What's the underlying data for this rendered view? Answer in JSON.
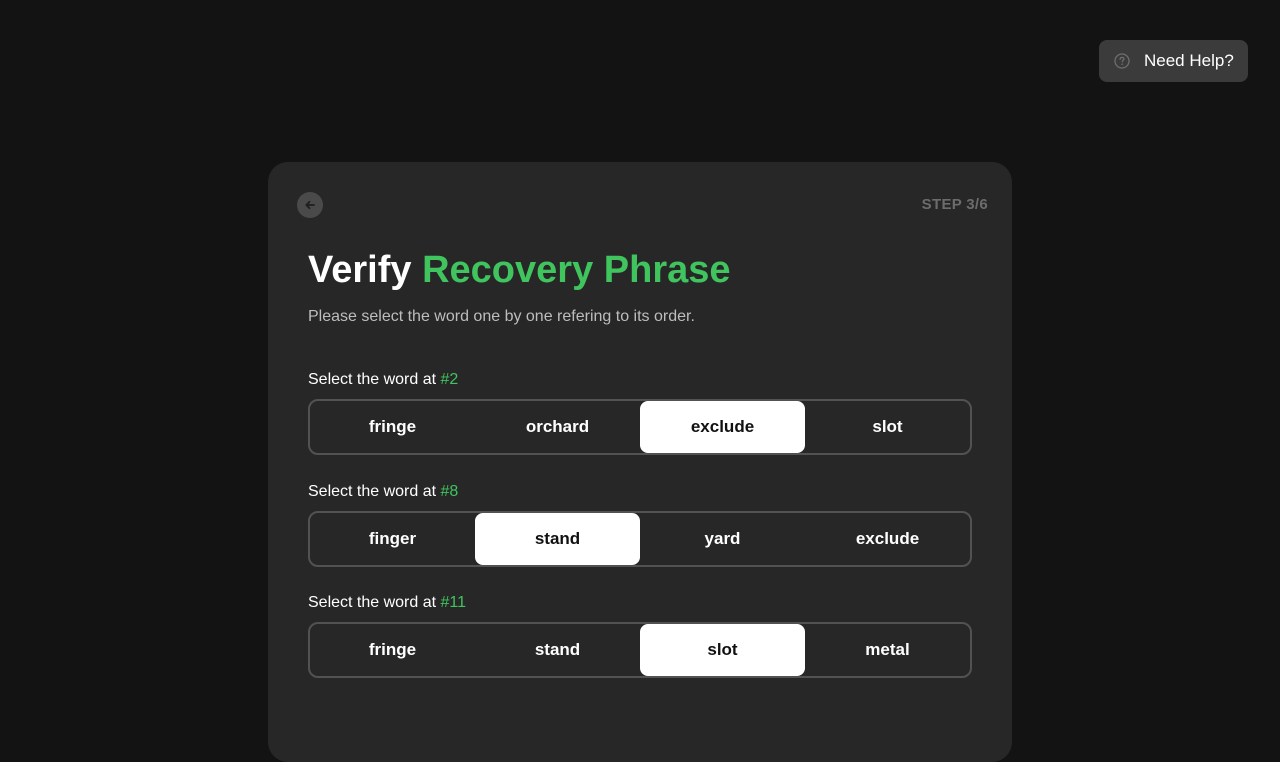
{
  "help": {
    "label": "Need Help?"
  },
  "card": {
    "step": "STEP 3/6",
    "title_main": "Verify",
    "title_accent": "Recovery Phrase",
    "subtitle": "Please select the word one by one refering to its order.",
    "accent_color": "#3fc45e"
  },
  "questions": [
    {
      "prefix": "Select the word at",
      "position": "#2",
      "options": [
        "fringe",
        "orchard",
        "exclude",
        "slot"
      ],
      "selected": "exclude"
    },
    {
      "prefix": "Select the word at",
      "position": "#8",
      "options": [
        "finger",
        "stand",
        "yard",
        "exclude"
      ],
      "selected": "stand"
    },
    {
      "prefix": "Select the word at",
      "position": "#11",
      "options": [
        "fringe",
        "stand",
        "slot",
        "metal"
      ],
      "selected": "slot"
    }
  ]
}
